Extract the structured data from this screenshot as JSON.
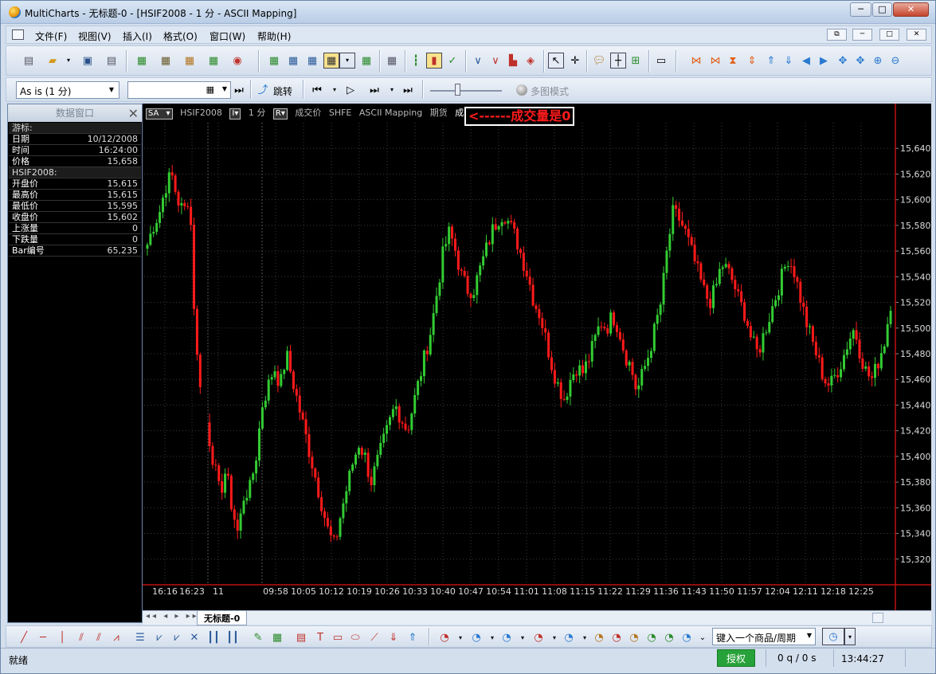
{
  "window": {
    "title": "MultiCharts - 无标题-0 - [HSIF2008 - 1 分 - ASCII Mapping]",
    "controls": {
      "minimize": "─",
      "maximize": "□",
      "close": "✕"
    }
  },
  "menu": {
    "items": [
      "文件(F)",
      "视图(V)",
      "插入(I)",
      "格式(O)",
      "窗口(W)",
      "帮助(H)"
    ]
  },
  "toolbar2": {
    "resolution": "As is (1 分)",
    "jump_label": "跳转",
    "multi_chart_label": "多图模式"
  },
  "data_window": {
    "title": "数据窗口",
    "rows": [
      {
        "key": "游标:",
        "value": "",
        "header": true
      },
      {
        "key": "日期",
        "value": "10/12/2008"
      },
      {
        "key": "时间",
        "value": "16:24:00"
      },
      {
        "key": "价格",
        "value": "15,658"
      },
      {
        "key": "HSIF2008:",
        "value": "",
        "header": true
      },
      {
        "key": "开盘价",
        "value": "15,615"
      },
      {
        "key": "最高价",
        "value": "15,615"
      },
      {
        "key": "最低价",
        "value": "15,595"
      },
      {
        "key": "收盘价",
        "value": "15,602"
      },
      {
        "key": "上涨量",
        "value": "0"
      },
      {
        "key": "下跌量",
        "value": "0"
      },
      {
        "key": "Bar编号",
        "value": "65,235"
      }
    ]
  },
  "chart_header": {
    "sa": "SA",
    "symbol": "HSIF2008",
    "interval": "1 分",
    "field": "成交价",
    "exchange": "SHFE",
    "mapping": "ASCII Mapping",
    "category": "期货",
    "volume": "成交量=0"
  },
  "annotation": "<------成交量是0",
  "chart_data": {
    "type": "candlestick",
    "title": "",
    "xlabel": "",
    "ylabel": "",
    "ylim": [
      15300,
      15660
    ],
    "y_ticks": [
      15320,
      15340,
      15360,
      15380,
      15400,
      15420,
      15440,
      15460,
      15480,
      15500,
      15520,
      15540,
      15560,
      15580,
      15600,
      15620,
      15640
    ],
    "y_tick_labels": [
      "15,320",
      "15,340",
      "15,360",
      "15,380",
      "15,400",
      "15,420",
      "15,440",
      "15,460",
      "15,480",
      "15,500",
      "15,520",
      "15,540",
      "15,560",
      "15,580",
      "15,600",
      "15,620",
      "15,640"
    ],
    "x_ticks": [
      "16:16",
      "16:23",
      "11",
      "09:58",
      "10:05",
      "10:12",
      "10:19",
      "10:26",
      "10:33",
      "10:40",
      "10:47",
      "10:54",
      "11:01",
      "11:08",
      "11:15",
      "11:22",
      "11:29",
      "11:36",
      "11:43",
      "11:50",
      "11:57",
      "12:04",
      "12:11",
      "12:18",
      "12:25"
    ],
    "grid": true,
    "up_color": "#33cc33",
    "down_color": "#ff1a1a",
    "background": "#000000",
    "close_path": [
      15565,
      15580,
      15590,
      15610,
      15620,
      15600,
      15590,
      15605,
      15485,
      15450,
      15420,
      15395,
      15370,
      15390,
      15360,
      15340,
      15370,
      15375,
      15400,
      15440,
      15455,
      15470,
      15455,
      15480,
      15460,
      15440,
      15420,
      15400,
      15380,
      15360,
      15340,
      15330,
      15355,
      15375,
      15395,
      15410,
      15400,
      15380,
      15395,
      15410,
      15425,
      15440,
      15430,
      15420,
      15440,
      15460,
      15480,
      15500,
      15530,
      15560,
      15575,
      15560,
      15540,
      15530,
      15530,
      15545,
      15560,
      15575,
      15585,
      15590,
      15580,
      15570,
      15555,
      15540,
      15520,
      15510,
      15490,
      15470,
      15455,
      15445,
      15460,
      15470,
      15465,
      15475,
      15490,
      15505,
      15500,
      15510,
      15500,
      15480,
      15470,
      15450,
      15465,
      15480,
      15500,
      15520,
      15560,
      15590,
      15585,
      15575,
      15560,
      15545,
      15530,
      15520,
      15530,
      15550,
      15545,
      15535,
      15520,
      15510,
      15490,
      15480,
      15495,
      15510,
      15525,
      15540,
      15555,
      15545,
      15525,
      15505,
      15490,
      15475,
      15460,
      15455,
      15465,
      15475,
      15490,
      15500,
      15480,
      15465,
      15460,
      15475,
      15490,
      15520
    ],
    "series": [
      {
        "name": "HSIF2008",
        "values": "close_path"
      }
    ]
  },
  "tabs": {
    "nav": "◂◂ ◂ ▸ ▸▸",
    "active": "无标题-0"
  },
  "toolbar3": {
    "symbol_placeholder": "键入一个商品/周期"
  },
  "status": {
    "text": "就绪",
    "auth": "授权",
    "queue": "0 q  /  0 s",
    "time": "13:44:27"
  },
  "icons": {
    "toolbar1": [
      "new-icon",
      "open-icon",
      "save-icon",
      "print-icon",
      "chart-icon",
      "quote-icon",
      "scanner-icon",
      "dom-icon",
      "record-icon",
      "insert-study-icon",
      "format-icon",
      "bar-chart-icon",
      "candle-icon",
      "check-icon",
      "trend-icon",
      "zoom-in-icon",
      "zoom-out-icon"
    ],
    "toolbar3": [
      "line-icon",
      "hline-icon",
      "vline-icon",
      "channel-icon",
      "fib-icon",
      "text-icon",
      "rect-icon",
      "ellipse-icon",
      "arrow-down-icon",
      "arrow-up-icon"
    ]
  }
}
